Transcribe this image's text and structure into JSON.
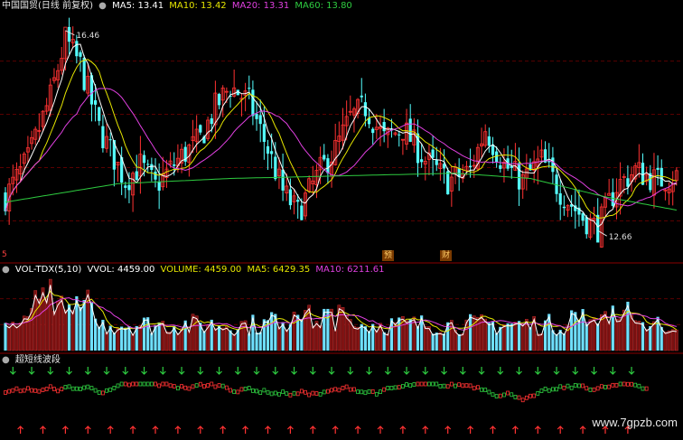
{
  "main_legend": {
    "name": "中国国贸(日线 前复权)",
    "ma5": "MA5: 13.41",
    "ma10": "MA10: 13.42",
    "ma20": "MA20: 13.31",
    "ma60": "MA60: 13.80",
    "colors": {
      "ma5": "#ffffff",
      "ma10": "#e6e600",
      "ma20": "#e040e0",
      "ma60": "#2ecc40"
    }
  },
  "vol_legend": {
    "name": "VOL-TDX(5,10)",
    "vvol": "VVOL: 4459.00",
    "volume": "VOLUME: 4459.00",
    "ma5": "MA5: 6429.35",
    "ma10": "MA10: 6211.61"
  },
  "ind_legend": {
    "name": "超短线波段"
  },
  "markers": {
    "high": "16.46",
    "low": "12.66",
    "event1": "预",
    "event2": "财",
    "event0": "5"
  },
  "watermark": "www.7gpzb.com",
  "chart_data": {
    "type": "candlestick",
    "price_range": [
      12.2,
      16.8
    ],
    "up_color": "#ff3232",
    "down_color": "#54ffff",
    "highest": 16.46,
    "lowest": 12.66,
    "close_path": [
      [
        0,
        13.3
      ],
      [
        6,
        14.0
      ],
      [
        12,
        15.2
      ],
      [
        16,
        16.3
      ],
      [
        20,
        15.8
      ],
      [
        25,
        14.6
      ],
      [
        32,
        13.6
      ],
      [
        36,
        13.9
      ],
      [
        40,
        13.5
      ],
      [
        46,
        14.0
      ],
      [
        52,
        14.4
      ],
      [
        56,
        15.0
      ],
      [
        60,
        15.4
      ],
      [
        65,
        15.1
      ],
      [
        70,
        14.2
      ],
      [
        74,
        13.4
      ],
      [
        78,
        13.0
      ],
      [
        84,
        13.8
      ],
      [
        88,
        14.2
      ],
      [
        92,
        14.8
      ],
      [
        96,
        15.0
      ],
      [
        101,
        14.4
      ],
      [
        106,
        14.6
      ],
      [
        112,
        14.0
      ],
      [
        118,
        13.6
      ],
      [
        124,
        13.8
      ],
      [
        128,
        14.6
      ],
      [
        133,
        13.9
      ],
      [
        138,
        13.6
      ],
      [
        143,
        14.0
      ],
      [
        148,
        13.4
      ],
      [
        154,
        12.9
      ],
      [
        158,
        12.7
      ],
      [
        163,
        13.5
      ],
      [
        168,
        13.8
      ],
      [
        174,
        13.6
      ],
      [
        179,
        13.7
      ]
    ],
    "ma60_path": [
      [
        0,
        13.2
      ],
      [
        30,
        13.55
      ],
      [
        60,
        13.65
      ],
      [
        90,
        13.7
      ],
      [
        120,
        13.75
      ],
      [
        140,
        13.65
      ],
      [
        160,
        13.3
      ],
      [
        179,
        13.05
      ]
    ],
    "volume_range": [
      0,
      16000
    ],
    "volume_ma5": 6429.35,
    "volume_ma10": 6211.61,
    "last_volume": 4459.0
  }
}
